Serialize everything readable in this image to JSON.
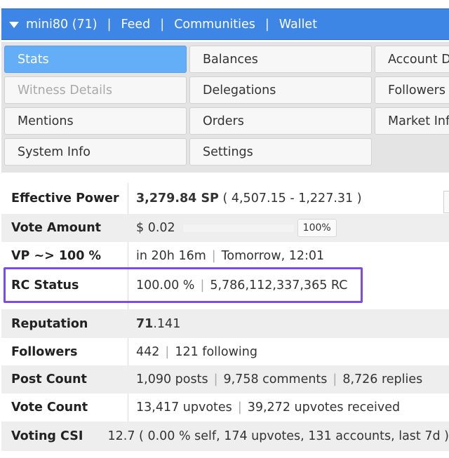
{
  "nav": {
    "user": "mini80 (71)",
    "links": [
      "Feed",
      "Communities",
      "Wallet"
    ],
    "separator": "|"
  },
  "tabs": [
    {
      "label": "Stats",
      "state": "active"
    },
    {
      "label": "Balances",
      "state": "normal"
    },
    {
      "label": "Account De",
      "state": "normal"
    },
    {
      "label": "Witness Details",
      "state": "disabled"
    },
    {
      "label": "Delegations",
      "state": "normal"
    },
    {
      "label": "Followers",
      "state": "normal"
    },
    {
      "label": "Mentions",
      "state": "normal"
    },
    {
      "label": "Orders",
      "state": "normal"
    },
    {
      "label": "Market Info",
      "state": "normal"
    },
    {
      "label": "System Info",
      "state": "normal"
    },
    {
      "label": "Settings",
      "state": "normal"
    }
  ],
  "stats": {
    "effective_power": {
      "label": "Effective Power",
      "value": "3,279.84 SP",
      "detail": "( 4,507.15 - 1,227.31 )"
    },
    "vote_amount": {
      "label": "Vote Amount",
      "value": "$ 0.02",
      "percent": "100%"
    },
    "vp": {
      "label": "VP ~> 100 %",
      "time": "in 20h 16m",
      "when": "Tomorrow, 12:01"
    },
    "rc_status": {
      "label": "RC Status",
      "percent": "100.00 %",
      "amount": "5,786,112,337,365 RC"
    },
    "reputation": {
      "label": "Reputation",
      "whole": "71",
      "fraction": ".141"
    },
    "followers": {
      "label": "Followers",
      "count": "442",
      "following": "121 following"
    },
    "post_count": {
      "label": "Post Count",
      "posts": "1,090 posts",
      "comments": "9,758 comments",
      "replies": "8,726 replies"
    },
    "vote_count": {
      "label": "Vote Count",
      "upvotes": "13,417 upvotes",
      "received": "39,272 upvotes received"
    },
    "voting_csi": {
      "label": "Voting CSI",
      "value": "12.7 ( 0.00 % self, 174 upvotes, 131 accounts, last 7d )"
    }
  },
  "colors": {
    "nav_bg": "#3d86e6",
    "active_tab": "#64aef7",
    "highlight": "#7b4ce8"
  }
}
